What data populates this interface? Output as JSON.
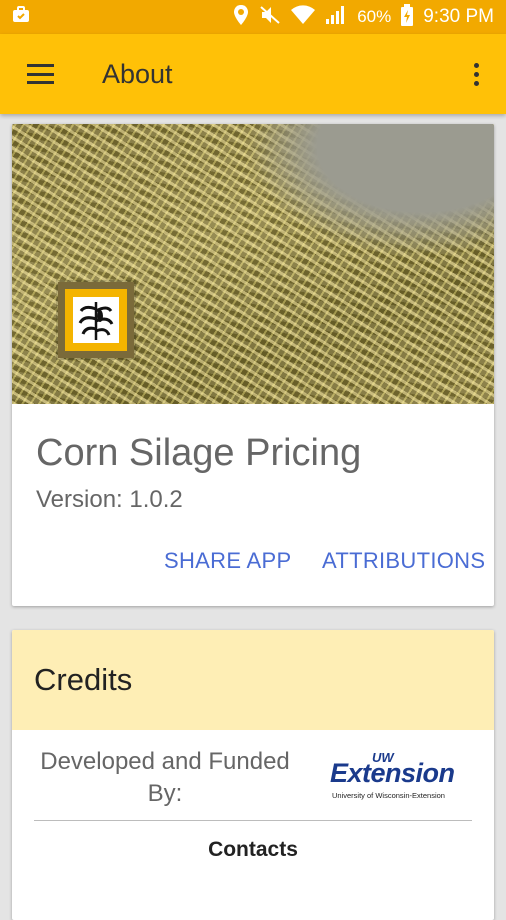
{
  "status_bar": {
    "battery_percent": "60%",
    "time": "9:30 PM",
    "icons": [
      "briefcase-icon",
      "location-icon",
      "mute-icon",
      "wifi-icon",
      "signal-icon",
      "battery-icon"
    ]
  },
  "app_bar": {
    "title": "About",
    "menu_icon": "hamburger-menu-icon",
    "overflow_icon": "more-vert-icon",
    "color": "#ffc107",
    "status_color": "#f2a900"
  },
  "about_card": {
    "app_name": "Corn Silage Pricing",
    "version": "Version: 1.0.2",
    "actions": {
      "share": "SHARE APP",
      "attributions": "ATTRIBUTIONS"
    },
    "accent_color": "#4a6cd4"
  },
  "credits_card": {
    "title": "Credits",
    "developed_by": "Developed and Funded By:",
    "logo": {
      "top": "UW",
      "main": "Extension",
      "sub": "University of Wisconsin-Extension"
    },
    "contacts_label": "Contacts",
    "header_color": "#feeeb5"
  }
}
